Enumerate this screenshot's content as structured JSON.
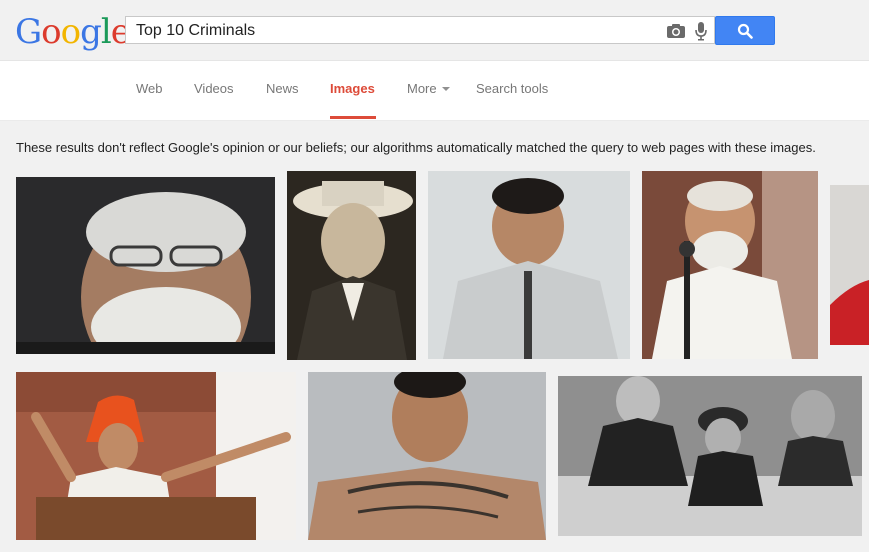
{
  "logo": {
    "letters": [
      "G",
      "o",
      "o",
      "g",
      "l",
      "e"
    ],
    "colors": [
      "#3b76e4",
      "#dc3b2d",
      "#f2b500",
      "#3b76e4",
      "#1b9a59",
      "#dc3b2d"
    ]
  },
  "search": {
    "query": "Top 10 Criminals",
    "icons": [
      "camera-icon",
      "microphone-icon",
      "magnifier-icon"
    ]
  },
  "nav": {
    "web": "Web",
    "videos": "Videos",
    "news": "News",
    "images": "Images",
    "more": "More",
    "search_tools": "Search tools"
  },
  "disclaimer": "These results don't reflect Google's opinion or our beliefs; our algorithms automatically matched the query to web pages with these images.",
  "colors": {
    "accent_red": "#dd4b39",
    "search_blue": "#4285f4",
    "nav_gray": "#777777"
  }
}
